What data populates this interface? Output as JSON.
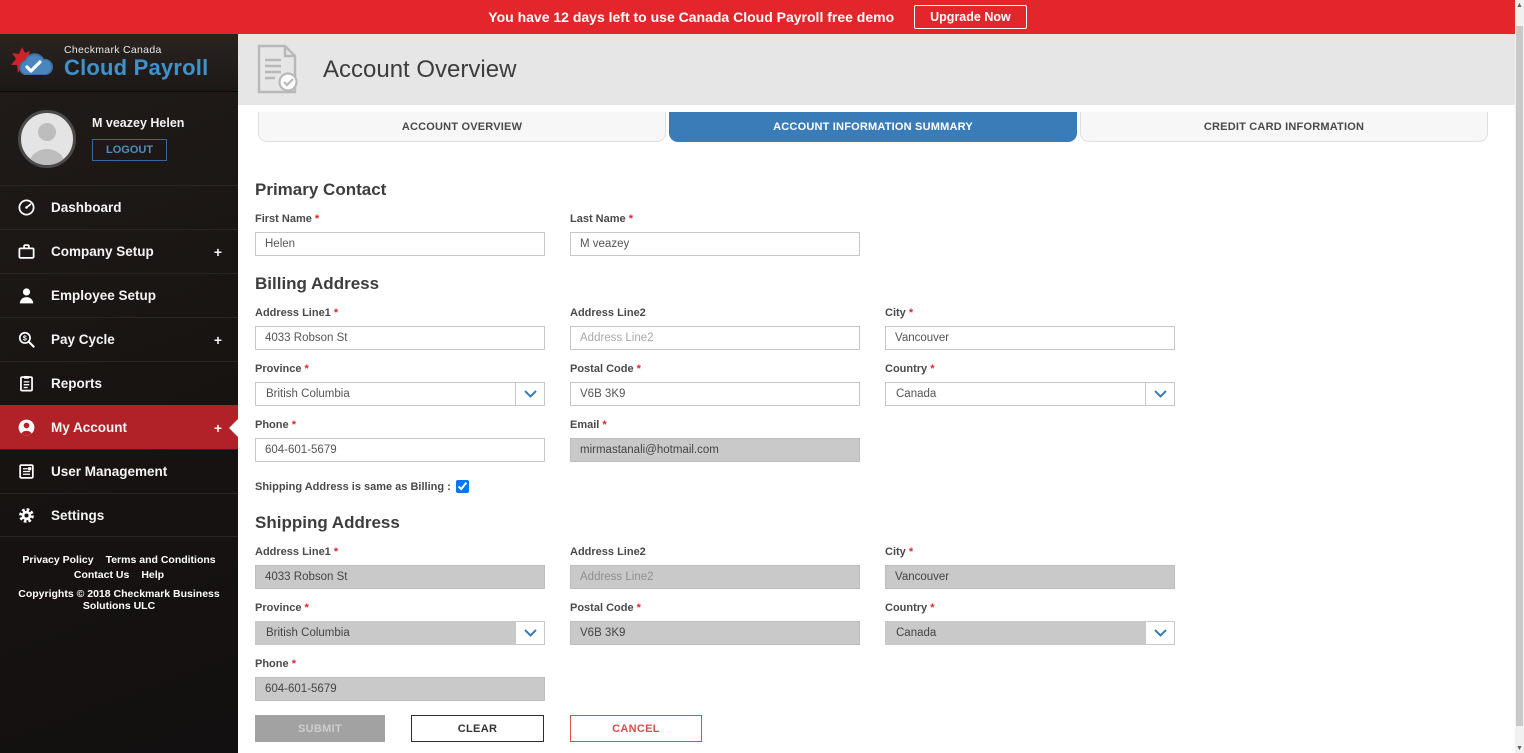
{
  "banner": {
    "message": "You have 12 days left to use Canada Cloud Payroll free demo",
    "upgrade_label": "Upgrade Now"
  },
  "sidebar": {
    "brand": {
      "line1": "Checkmark Canada",
      "line2": "Cloud Payroll"
    },
    "user": {
      "name": "M veazey Helen",
      "logout_label": "LOGOUT"
    },
    "expand_glyph": "+",
    "nav": [
      {
        "label": "Dashboard"
      },
      {
        "label": "Company Setup"
      },
      {
        "label": "Employee Setup"
      },
      {
        "label": "Pay Cycle"
      },
      {
        "label": "Reports"
      },
      {
        "label": "My Account"
      },
      {
        "label": "User Management"
      },
      {
        "label": "Settings"
      }
    ],
    "links": {
      "privacy": "Privacy Policy",
      "terms": "Terms and Conditions",
      "contact": "Contact Us",
      "help": "Help"
    },
    "copyright": "Copyrights © 2018 Checkmark Business Solutions ULC"
  },
  "header": {
    "title": "Account Overview"
  },
  "tabs": [
    {
      "label": "ACCOUNT OVERVIEW"
    },
    {
      "label": "ACCOUNT INFORMATION SUMMARY"
    },
    {
      "label": "CREDIT CARD INFORMATION"
    }
  ],
  "form": {
    "required": "*",
    "primary": {
      "heading": "Primary Contact",
      "first_name": {
        "label": "First Name",
        "value": "Helen"
      },
      "last_name": {
        "label": "Last Name",
        "value": "M veazey"
      }
    },
    "billing": {
      "heading": "Billing Address",
      "address1": {
        "label": "Address Line1",
        "value": "4033 Robson St"
      },
      "address2": {
        "label": "Address Line2",
        "placeholder": "Address Line2"
      },
      "city": {
        "label": "City",
        "value": "Vancouver"
      },
      "province": {
        "label": "Province",
        "value": "British Columbia"
      },
      "postal_code": {
        "label": "Postal Code",
        "value": "V6B 3K9"
      },
      "country": {
        "label": "Country",
        "value": "Canada"
      },
      "phone": {
        "label": "Phone",
        "value": "604-601-5679"
      },
      "email": {
        "label": "Email",
        "value": "mirmastanali@hotmail.com"
      }
    },
    "same_as_billing_label": "Shipping Address is same as Billing :",
    "shipping": {
      "heading": "Shipping Address",
      "address1": {
        "label": "Address Line1",
        "value": "4033 Robson St"
      },
      "address2": {
        "label": "Address Line2",
        "placeholder": "Address Line2"
      },
      "city": {
        "label": "City",
        "value": "Vancouver"
      },
      "province": {
        "label": "Province",
        "value": "British Columbia"
      },
      "postal_code": {
        "label": "Postal Code",
        "value": "V6B 3K9"
      },
      "country": {
        "label": "Country",
        "value": "Canada"
      },
      "phone": {
        "label": "Phone",
        "value": "604-601-5679"
      }
    },
    "buttons": {
      "submit": "SUBMIT",
      "clear": "CLEAR",
      "cancel": "CANCEL"
    }
  },
  "colors": {
    "banner_red": "#e2262c",
    "nav_active_red": "#b02227",
    "accent_blue": "#3a7cb8",
    "logo_blue": "#3f93cc",
    "disabled_gray": "#c9c9c9"
  }
}
